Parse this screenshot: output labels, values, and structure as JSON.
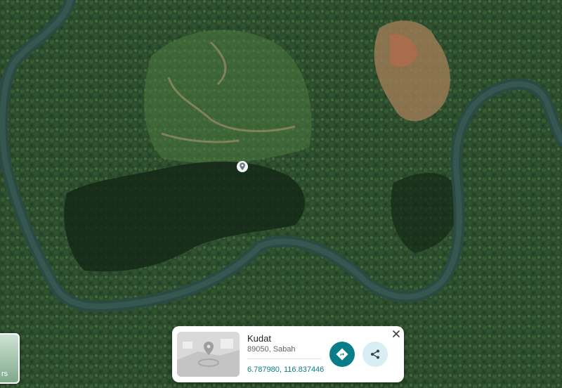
{
  "place": {
    "name": "Kudat",
    "address": "89050, Sabah",
    "coordinates": "6.787980, 116.837446"
  },
  "layers": {
    "label": "rs"
  },
  "icons": {
    "pin": "location-pin-icon",
    "directions": "directions-icon",
    "share": "share-icon",
    "close": "close-icon"
  },
  "colors": {
    "accent": "#0b7d88",
    "share_bg": "#d7eef5",
    "river": "#2c4a44"
  }
}
